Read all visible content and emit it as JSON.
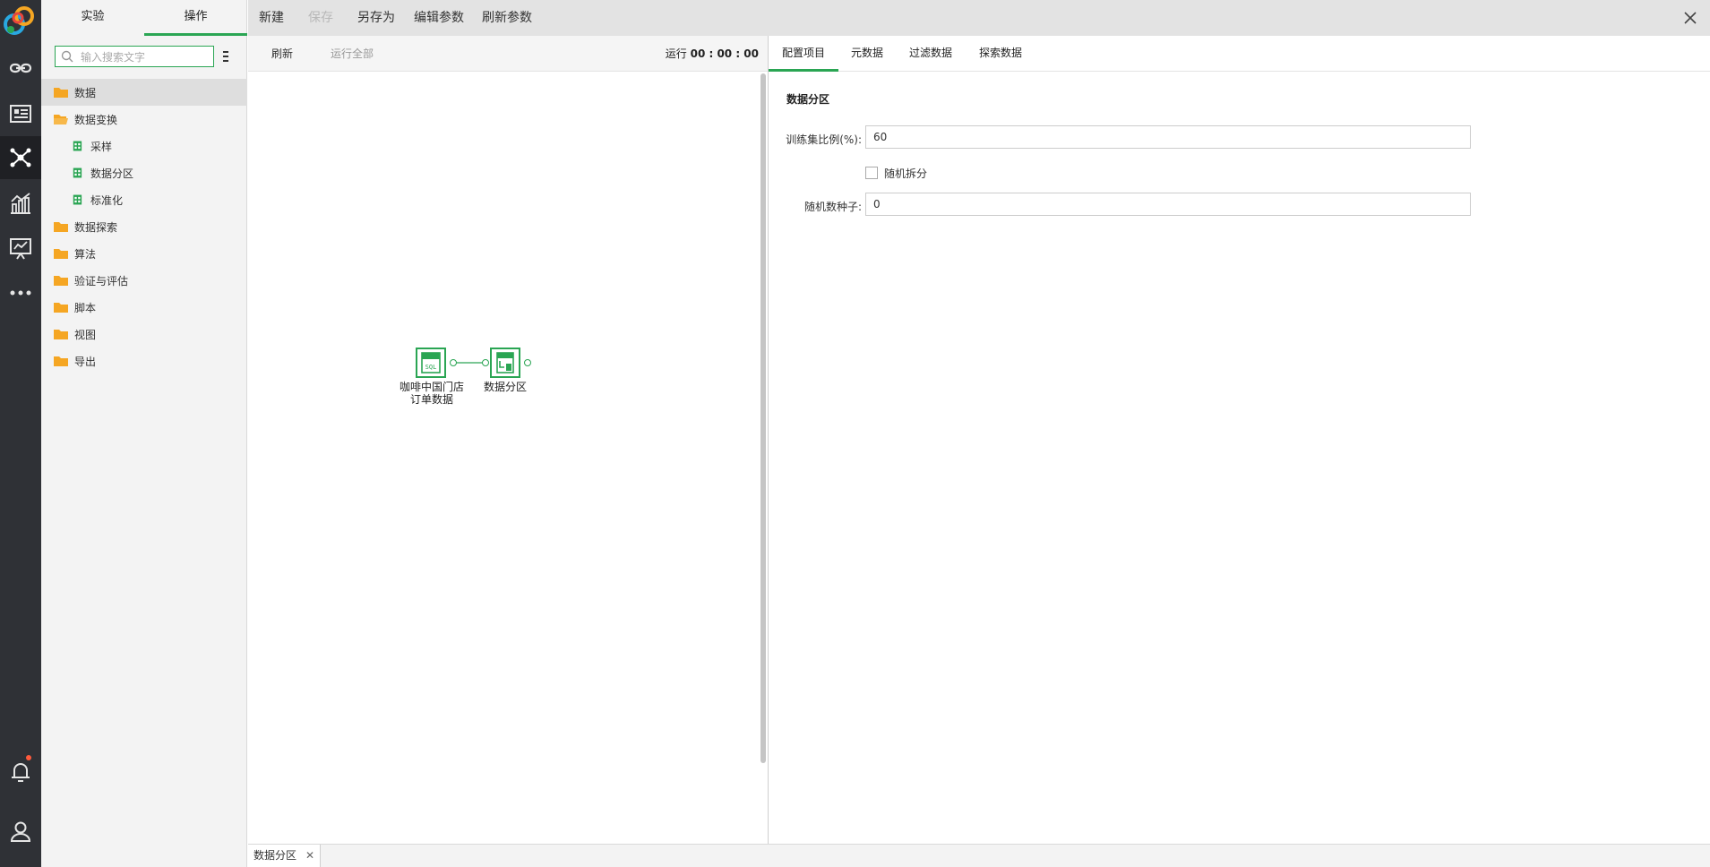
{
  "left_panel": {
    "tabs": [
      {
        "label": "实验"
      },
      {
        "label": "操作"
      }
    ],
    "search": {
      "placeholder": "输入搜索文字",
      "value": ""
    },
    "tree": [
      {
        "label": "数据",
        "type": "folder",
        "selected": true
      },
      {
        "label": "数据变换",
        "type": "folder-open"
      },
      {
        "label": "采样",
        "type": "operator"
      },
      {
        "label": "数据分区",
        "type": "operator"
      },
      {
        "label": "标准化",
        "type": "operator"
      },
      {
        "label": "数据探索",
        "type": "folder"
      },
      {
        "label": "算法",
        "type": "folder"
      },
      {
        "label": "验证与评估",
        "type": "folder"
      },
      {
        "label": "脚本",
        "type": "folder"
      },
      {
        "label": "视图",
        "type": "folder"
      },
      {
        "label": "导出",
        "type": "folder"
      }
    ]
  },
  "toolbar": {
    "new": "新建",
    "save": "保存",
    "save_as": "另存为",
    "edit_params": "编辑参数",
    "refresh_params": "刷新参数"
  },
  "canvas": {
    "refresh": "刷新",
    "run_all": "运行全部",
    "run_label": "运行",
    "run_time": "00 : 00 : 00",
    "nodes": [
      {
        "label_line1": "咖啡中国门店",
        "label_line2": "订单数据",
        "icon": "sql-icon"
      },
      {
        "label": "数据分区",
        "icon": "partition-icon"
      }
    ]
  },
  "right_panel": {
    "tabs": [
      {
        "label": "配置项目"
      },
      {
        "label": "元数据"
      },
      {
        "label": "过滤数据"
      },
      {
        "label": "探索数据"
      }
    ],
    "section_title": "数据分区",
    "fields": {
      "train_ratio": {
        "label": "训练集比例(%):",
        "value": "60"
      },
      "random_split": {
        "label": "随机拆分",
        "checked": false
      },
      "random_seed": {
        "label": "随机数种子:",
        "value": "0"
      }
    }
  },
  "bottom_tabs": [
    {
      "label": "数据分区"
    }
  ],
  "colors": {
    "accent": "#2aa553",
    "folder": "#f5a623",
    "rail": "#2f3136"
  }
}
